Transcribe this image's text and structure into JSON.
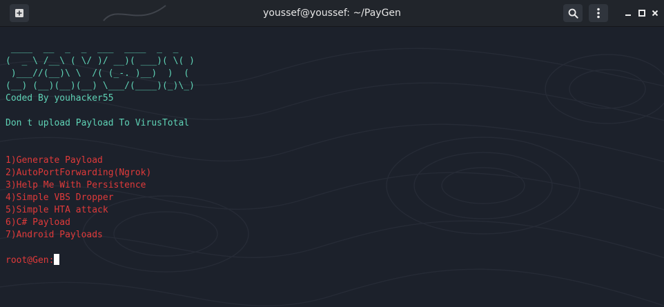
{
  "window": {
    "title": "youssef@youssef: ~/PayGen"
  },
  "icons": {
    "new_tab": "new-tab-icon",
    "search": "search-icon",
    "menu": "kebab-menu-icon",
    "minimize": "minimize-icon",
    "maximize": "maximize-icon",
    "close": "close-icon"
  },
  "terminal": {
    "banner": [
      " ____  __  _  _  ___  ____  _  _ ",
      "(  _ \\ /__\\ ( \\/ )/ __)( ___)( \\( )",
      " )___//(__)\\ \\  /( (_-. )__)  )  ( ",
      "(__) (__)(__)(__) \\___/(____)(_)\\_)"
    ],
    "credit": "Coded By youhacker55",
    "warning": "Don t upload Payload To VirusTotal",
    "menu": [
      "1)Generate Payload",
      "2)AutoPortForwarding(Ngrok)",
      "3)Help Me With Persistence",
      "4)Simple VBS Dropper",
      "5)Simple HTA attack",
      "6)C# Payload",
      "7)Android Payloads"
    ],
    "prompt": "root@Gen:"
  },
  "colors": {
    "background": "#1c212b",
    "titlebar": "#21252b",
    "banner_text": "#5fd3b6",
    "menu_text": "#e03a3a",
    "cursor": "#ffffff"
  }
}
